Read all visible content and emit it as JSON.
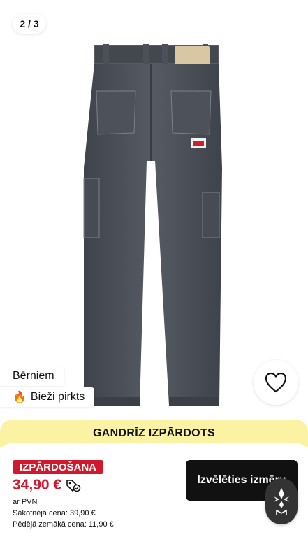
{
  "gallery": {
    "counter": "2 / 3",
    "image_alt": "jeans-back-view"
  },
  "badges": {
    "category": "Bērniem",
    "popular": "Bieži pirkts",
    "popular_icon": "fire-icon"
  },
  "wishlist": {
    "icon": "heart-icon"
  },
  "banner": {
    "text": "GANDRĪZ IZPĀRDOTS"
  },
  "product": {
    "sale_label": "IZPĀRDOŠANA",
    "price": "34,90 €",
    "vat": "ar PVN",
    "original_price": "Sākotnējā cena: 39,90 €",
    "lowest_price": "Pēdējā zemākā cena: 11,90 €"
  },
  "actions": {
    "select_size": "Izvēlēties izmēru"
  },
  "colors": {
    "sale_red": "#d1182c",
    "banner_yellow": "#fbf2a4",
    "button_black": "#111111",
    "denim": "#4a4f57"
  }
}
